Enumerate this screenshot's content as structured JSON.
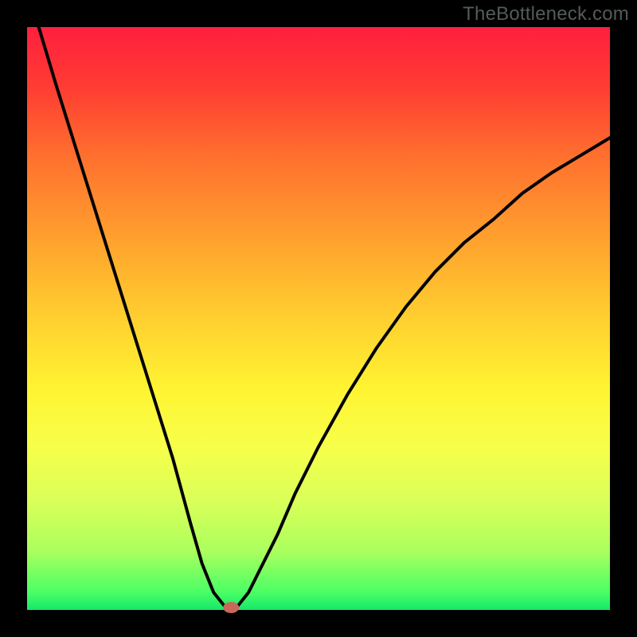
{
  "watermark": "TheBottleneck.com",
  "chart_data": {
    "type": "line",
    "title": "",
    "xlabel": "",
    "ylabel": "",
    "xlim": [
      0,
      100
    ],
    "ylim": [
      0,
      100
    ],
    "grid": false,
    "series": [
      {
        "name": "bottleneck-curve",
        "x": [
          2,
          5,
          10,
          15,
          20,
          25,
          28,
          30,
          32,
          34,
          35,
          36,
          38,
          40,
          43,
          46,
          50,
          55,
          60,
          65,
          70,
          75,
          80,
          85,
          90,
          95,
          100
        ],
        "y": [
          100,
          90,
          74,
          58,
          42,
          26,
          15,
          8,
          3,
          0.5,
          0,
          0.5,
          3,
          7,
          13,
          20,
          28,
          37,
          45,
          52,
          58,
          63,
          67,
          71.5,
          75,
          78,
          81
        ]
      }
    ],
    "annotations": [
      {
        "name": "min-marker",
        "x": 35,
        "y": 0,
        "color": "#c8675a"
      }
    ]
  }
}
